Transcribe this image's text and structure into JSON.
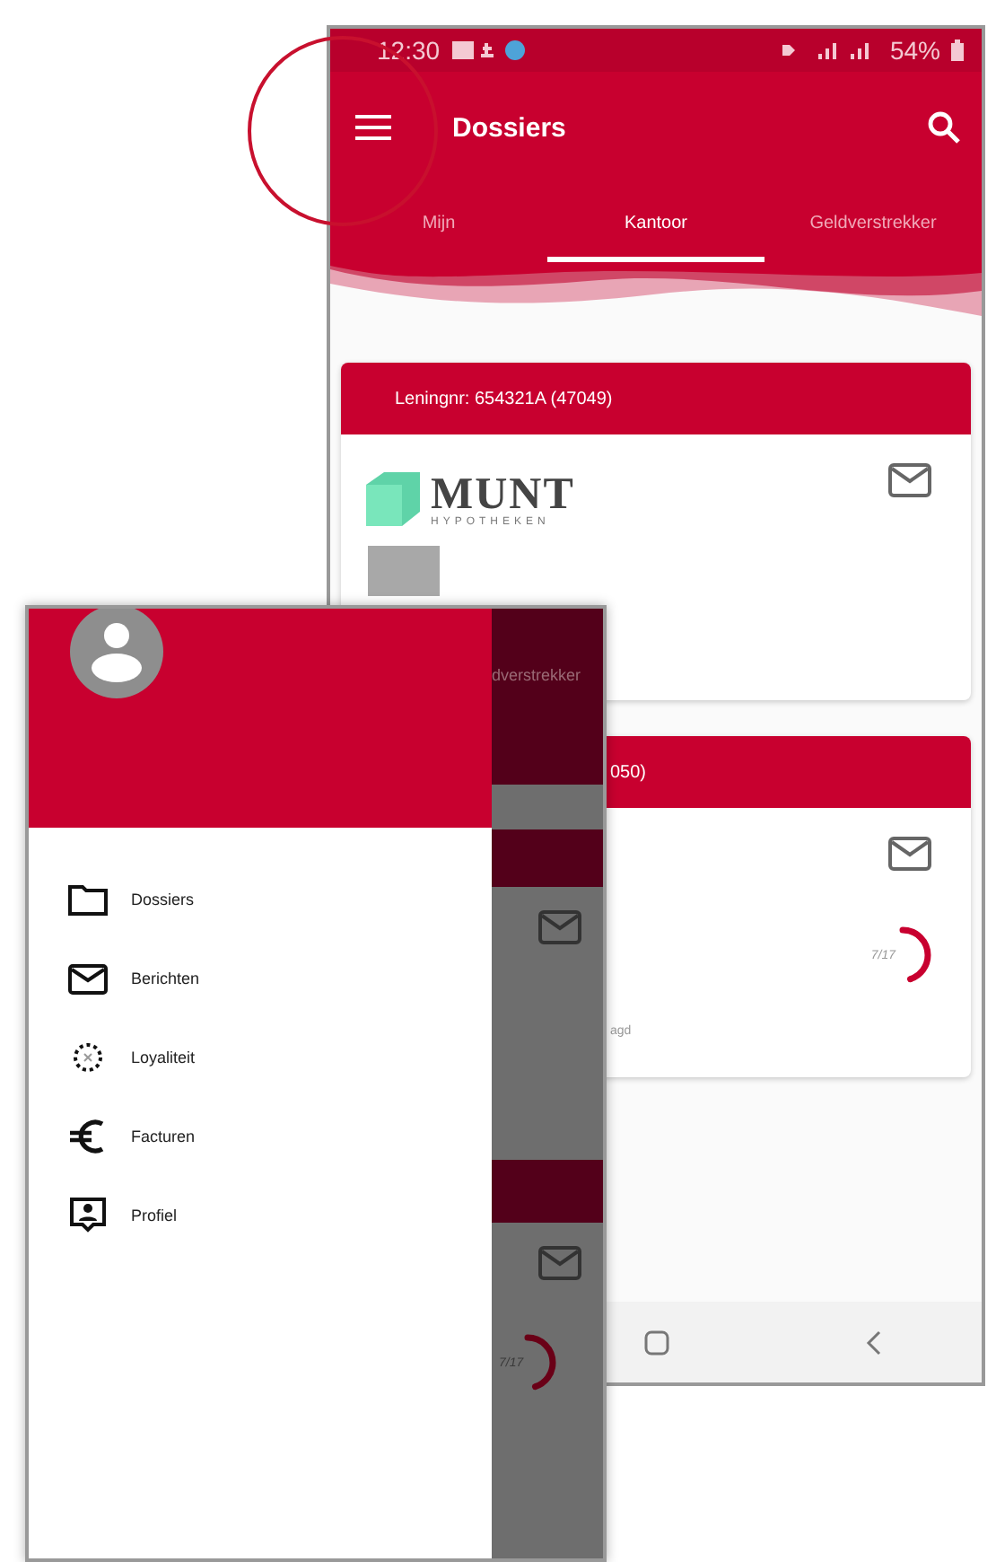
{
  "back_screen": {
    "status_bar": {
      "time": "12:30",
      "battery": "54%"
    },
    "app_bar": {
      "title": "Dossiers"
    },
    "tabs": [
      {
        "label": "Mijn",
        "selected": false
      },
      {
        "label": "Kantoor",
        "selected": true
      },
      {
        "label": "Geldverstrekker",
        "selected": false
      }
    ],
    "cards": [
      {
        "header": "Leningnr: 654321A (47049)",
        "logo": {
          "name": "MUNT",
          "subtitle": "HYPOTHEKEN"
        }
      },
      {
        "header": "050)",
        "progress": {
          "label": "7/17",
          "level": 0.45
        },
        "caption": "agd"
      }
    ]
  },
  "front_screen": {
    "drawer": {
      "items": [
        {
          "label": "Dossiers"
        },
        {
          "label": "Berichten"
        },
        {
          "label": "Loyaliteit"
        },
        {
          "label": "Facturen"
        },
        {
          "label": "Profiel"
        }
      ]
    },
    "background": {
      "tab_fragment": "dverstrekker",
      "progress": {
        "label": "7/17",
        "level": 0.45
      }
    }
  }
}
